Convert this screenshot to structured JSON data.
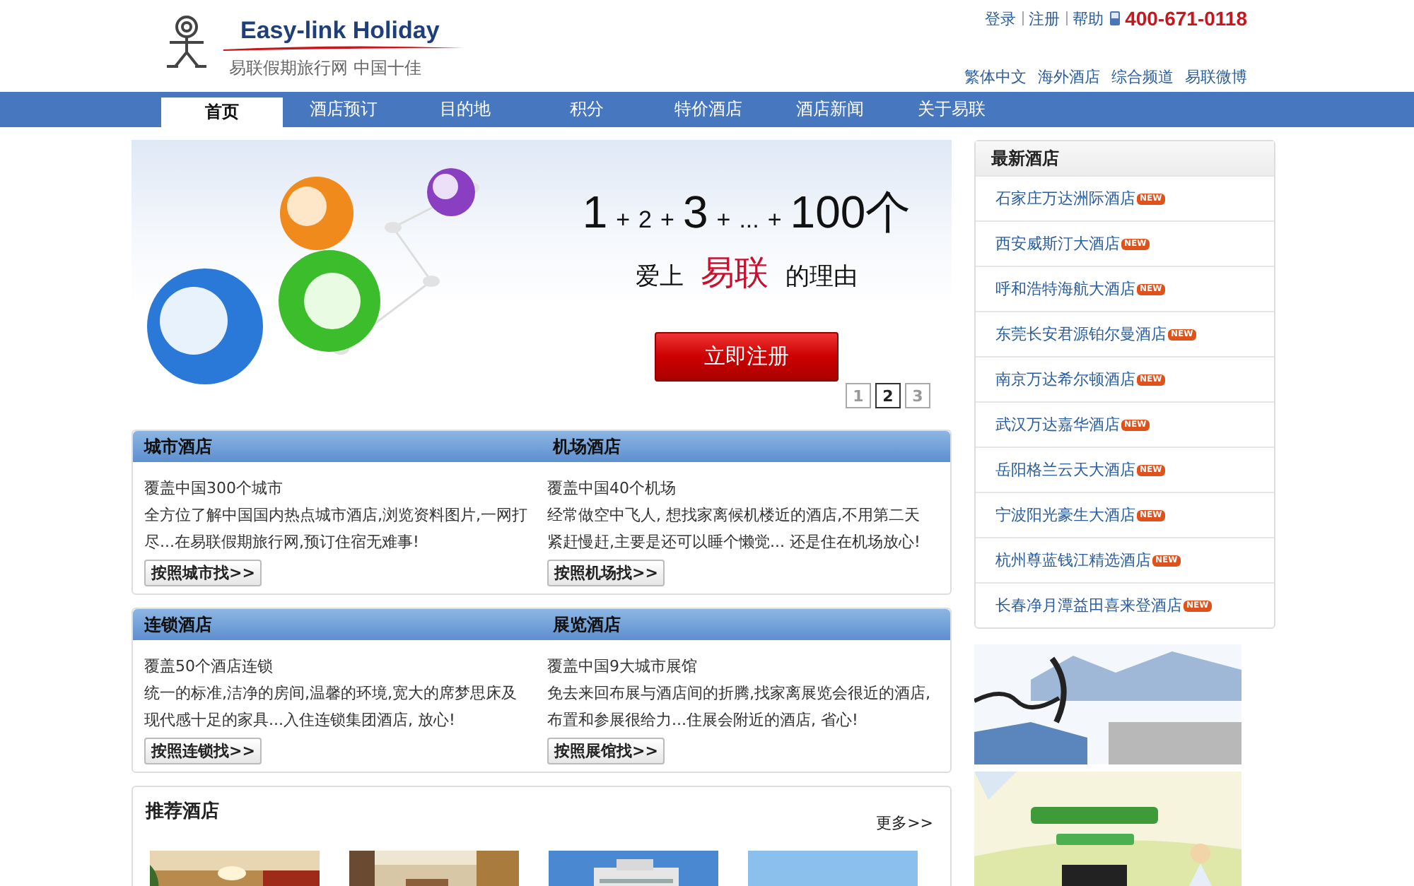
{
  "logo": {
    "title": "Easy-link Holiday",
    "tagline": "易联假期旅行网 中国十佳"
  },
  "top_links": [
    {
      "label": "登录"
    },
    {
      "label": "注册"
    },
    {
      "label": "帮助"
    }
  ],
  "phone": "400-671-0118",
  "sub_links": [
    "繁体中文",
    "海外酒店",
    "综合频道",
    "易联微博"
  ],
  "nav": [
    {
      "label": "首页",
      "selected": true
    },
    {
      "label": "酒店预订",
      "selected": false
    },
    {
      "label": "目的地",
      "selected": false
    },
    {
      "label": "积分",
      "selected": false
    },
    {
      "label": "特价酒店",
      "selected": false
    },
    {
      "label": "酒店新闻",
      "selected": false
    },
    {
      "label": "关于易联",
      "selected": false
    }
  ],
  "hero": {
    "formula": [
      {
        "text": "1",
        "big": true
      },
      {
        "text": "+",
        "big": false
      },
      {
        "text": "2",
        "big": false
      },
      {
        "text": "+",
        "big": false
      },
      {
        "text": "3",
        "big": true
      },
      {
        "text": "+",
        "big": false
      },
      {
        "text": "...",
        "big": false
      },
      {
        "text": "+",
        "big": false
      },
      {
        "text": "100个",
        "big": true
      }
    ],
    "slogan": [
      {
        "text": "爱上",
        "highlight": false
      },
      {
        "text": "易联",
        "highlight": true
      },
      {
        "text": "的理由",
        "highlight": false
      }
    ],
    "button": "立即注册",
    "pages": [
      {
        "label": "1",
        "selected": false
      },
      {
        "label": "2",
        "selected": true
      },
      {
        "label": "3",
        "selected": false
      }
    ]
  },
  "panels": [
    {
      "columns": [
        {
          "title": "城市酒店",
          "subtitle": "覆盖中国300个城市",
          "text": "全方位了解中国国内热点城市酒店,浏览资料图片,一网打尽...在易联假期旅行网,预订住宿无难事!",
          "button": "按照城市找>>"
        },
        {
          "title": "机场酒店",
          "subtitle": "覆盖中国40个机场",
          "text": "经常做空中飞人, 想找家离候机楼近的酒店,不用第二天紧赶慢赶,主要是还可以睡个懒觉... 还是住在机场放心!",
          "button": "按照机场找>>"
        }
      ]
    },
    {
      "columns": [
        {
          "title": "连锁酒店",
          "subtitle": "覆盖50个酒店连锁",
          "text": "统一的标准,洁净的房间,温馨的环境,宽大的席梦思床及现代感十足的家具...入住连锁集团酒店, 放心!",
          "button": "按照连锁找>>"
        },
        {
          "title": "展览酒店",
          "subtitle": "覆盖中国9大城市展馆",
          "text": "免去来回布展与酒店间的折腾,找家离展览会很近的酒店,布置和参展很给力...住展会附近的酒店, 省心!",
          "button": "按照展馆找>>"
        }
      ]
    }
  ],
  "recommended": {
    "title": "推荐酒店",
    "more": "更多>>"
  },
  "new_hotels": {
    "title": "最新酒店",
    "items": [
      {
        "name": "石家庄万达洲际酒店",
        "badge": "NEW"
      },
      {
        "name": "西安威斯汀大酒店",
        "badge": "NEW"
      },
      {
        "name": "呼和浩特海航大酒店",
        "badge": "NEW"
      },
      {
        "name": "东莞长安君源铂尔曼酒店",
        "badge": "NEW"
      },
      {
        "name": "南京万达希尔顿酒店",
        "badge": "NEW"
      },
      {
        "name": "武汉万达嘉华酒店",
        "badge": "NEW"
      },
      {
        "name": "岳阳格兰云天大酒店",
        "badge": "NEW"
      },
      {
        "name": "宁波阳光豪生大酒店",
        "badge": "NEW"
      },
      {
        "name": "杭州尊蓝钱江精选酒店",
        "badge": "NEW"
      },
      {
        "name": "长春净月潭益田喜来登酒店",
        "badge": "NEW"
      }
    ]
  }
}
